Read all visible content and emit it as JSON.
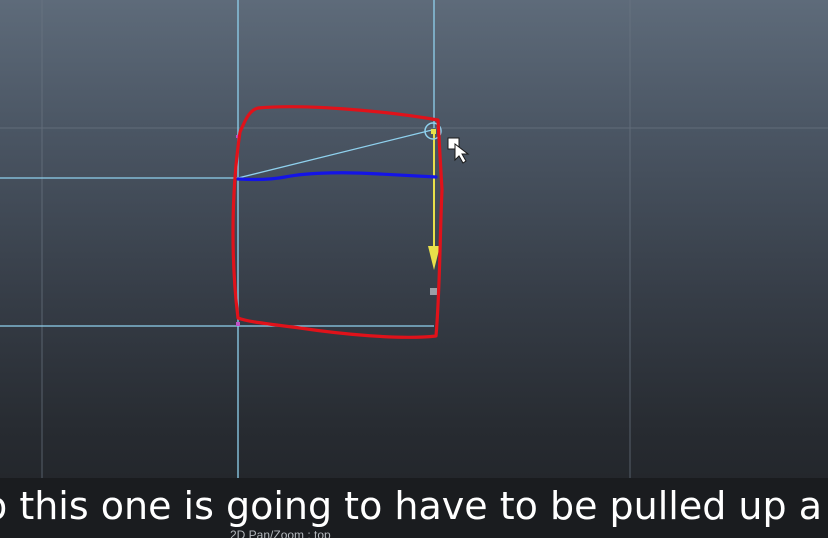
{
  "viewport": {
    "view_label": "2D Pan/Zoom : top",
    "grid_color": "#6d7885",
    "curve_color": "#8fd1ee",
    "annotation_red": "#e0121a",
    "annotation_blue": "#1414e6",
    "manipulator_color": "#e8e04a"
  },
  "caption": {
    "text": "o this one is going to have to be pulled up a lit"
  },
  "icons": {
    "cursor": "move-cursor-icon",
    "pivot": "pivot-circle-icon",
    "arrow": "move-arrow-icon"
  }
}
